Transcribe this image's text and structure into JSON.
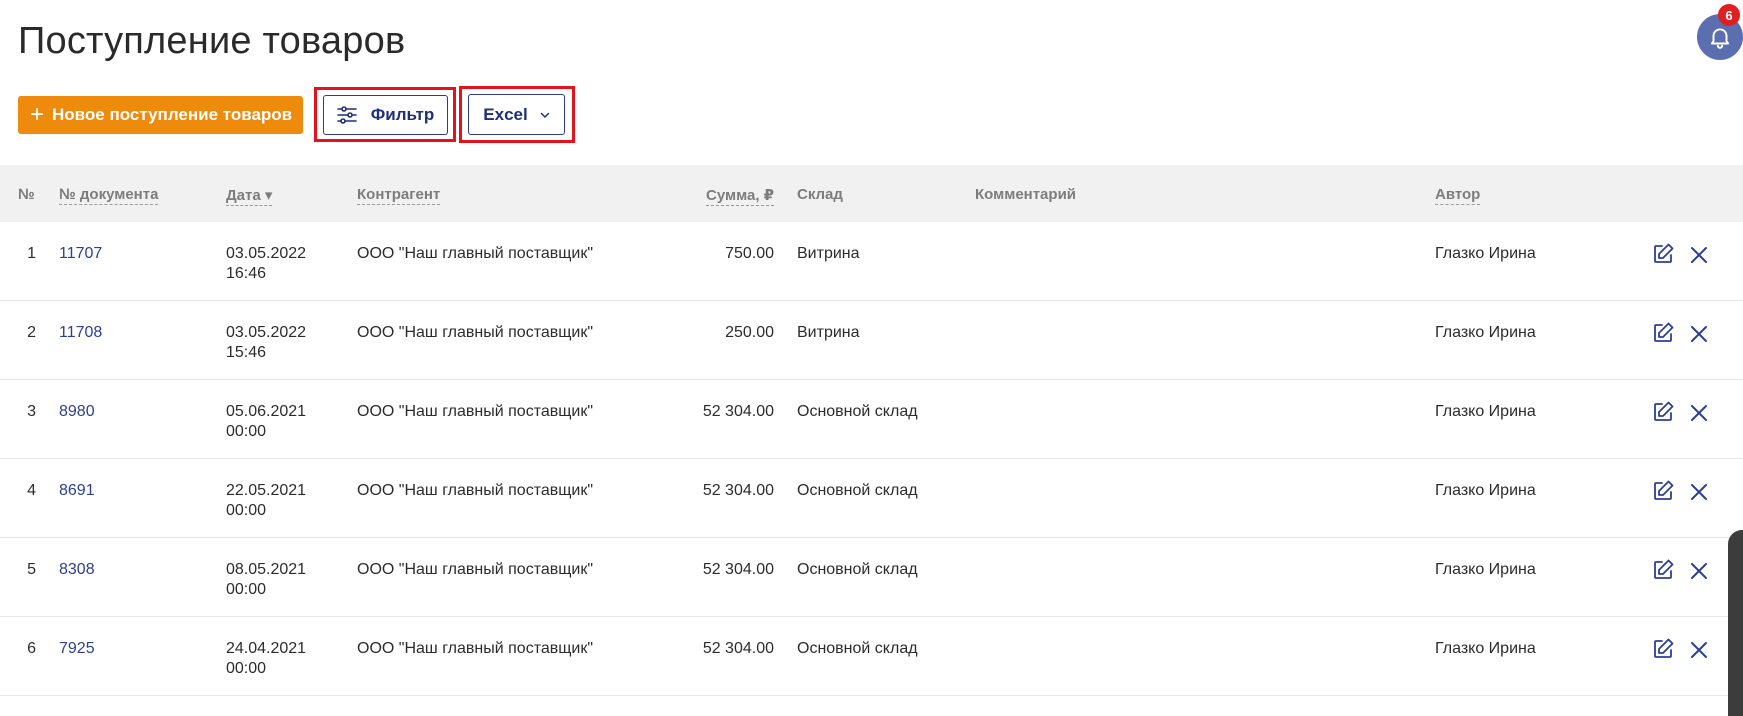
{
  "page": {
    "title": "Поступление товаров"
  },
  "notifications": {
    "count": "6",
    "icon": "bell-icon"
  },
  "toolbar": {
    "new_label": "Новое поступление товаров",
    "filter_label": "Фильтр",
    "excel_label": "Excel"
  },
  "table": {
    "headers": {
      "num": "№",
      "doc": "№ документа",
      "date": "Дата ▾",
      "contractor": "Контрагент",
      "sum": "Сумма, ₽",
      "warehouse": "Склад",
      "comment": "Комментарий",
      "author": "Автор"
    },
    "rows": [
      {
        "num": "1",
        "doc": "11707",
        "date": "03.05.2022",
        "time": "16:46",
        "contractor": "ООО \"Наш главный поставщик\"",
        "sum": "750.00",
        "warehouse": "Витрина",
        "comment": "",
        "author": "Глазко Ирина"
      },
      {
        "num": "2",
        "doc": "11708",
        "date": "03.05.2022",
        "time": "15:46",
        "contractor": "ООО \"Наш главный поставщик\"",
        "sum": "250.00",
        "warehouse": "Витрина",
        "comment": "",
        "author": "Глазко Ирина"
      },
      {
        "num": "3",
        "doc": "8980",
        "date": "05.06.2021",
        "time": "00:00",
        "contractor": "ООО \"Наш главный поставщик\"",
        "sum": "52 304.00",
        "warehouse": "Основной склад",
        "comment": "",
        "author": "Глазко Ирина"
      },
      {
        "num": "4",
        "doc": "8691",
        "date": "22.05.2021",
        "time": "00:00",
        "contractor": "ООО \"Наш главный поставщик\"",
        "sum": "52 304.00",
        "warehouse": "Основной склад",
        "comment": "",
        "author": "Глазко Ирина"
      },
      {
        "num": "5",
        "doc": "8308",
        "date": "08.05.2021",
        "time": "00:00",
        "contractor": "ООО \"Наш главный поставщик\"",
        "sum": "52 304.00",
        "warehouse": "Основной склад",
        "comment": "",
        "author": "Глазко Ирина"
      },
      {
        "num": "6",
        "doc": "7925",
        "date": "24.04.2021",
        "time": "00:00",
        "contractor": "ООО \"Наш главный поставщик\"",
        "sum": "52 304.00",
        "warehouse": "Основной склад",
        "comment": "",
        "author": "Глазко Ирина"
      }
    ]
  },
  "colors": {
    "accent_orange": "#ee8a0c",
    "link_blue": "#2c3f95",
    "highlight_red": "#e3121c",
    "badge_red": "#e02020"
  }
}
